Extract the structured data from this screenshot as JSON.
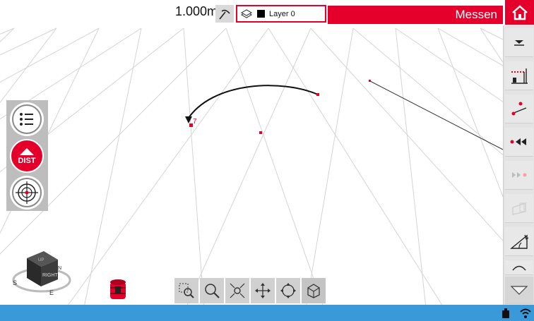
{
  "toolbar": {
    "scale": "1.000m",
    "layer_name": "Layer 0",
    "mode": "Messen"
  },
  "left_panel": {
    "dist_label": "DIST"
  },
  "cube": {
    "face_top": "UP",
    "face_front": "RIGHT",
    "compass": [
      "S",
      "E",
      "N"
    ]
  },
  "canvas": {
    "point_label": "7"
  },
  "colors": {
    "accent": "#e4002b",
    "status_bar": "#3a9ad9",
    "panel": "#e3e3e3"
  },
  "icons": {
    "right_panel": [
      "chevron-down-icon",
      "level-measure-icon",
      "point-line-icon",
      "rewind-icon",
      "forward-icon",
      "wall-icon",
      "angle-icon",
      "arc-icon",
      "triangle-down-icon"
    ],
    "bottom": [
      "zoom-window-icon",
      "zoom-icon",
      "zoom-extents-icon",
      "pan-icon",
      "orbit-icon",
      "box-view-icon"
    ]
  }
}
